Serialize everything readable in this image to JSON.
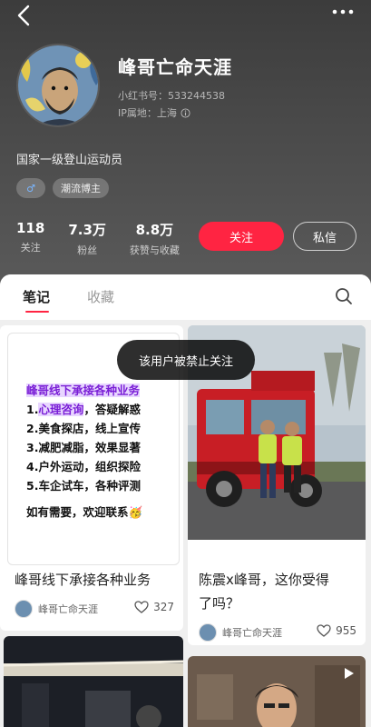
{
  "profile": {
    "name": "峰哥亡命天涯",
    "red_id": "小红书号：533244538",
    "ip": "IP属地：上海",
    "bio": "国家一级登山运动员",
    "tags": [
      "♂",
      "潮流博主"
    ],
    "stats": [
      {
        "value": "118",
        "label": "关注"
      },
      {
        "value": "7.3万",
        "label": "粉丝"
      },
      {
        "value": "8.8万",
        "label": "获赞与收藏"
      }
    ],
    "follow_label": "关注",
    "message_label": "私信"
  },
  "tabs": {
    "notes": "笔记",
    "collections": "收藏"
  },
  "toast": "该用户被禁止关注",
  "posts": [
    {
      "title": "峰哥线下承接各种业务",
      "author": "峰哥亡命天涯",
      "likes": "327",
      "image_lines": {
        "header": "峰哥线下承接各种业务",
        "l1_num": "1.",
        "l1_hl": "心理咨询",
        "l1_rest": "，答疑解惑",
        "l2": "2.美食探店，线上宣传",
        "l3": "3.减肥减脂，效果显著",
        "l4": "4.户外运动，组织探险",
        "l5": "5.车企试车，各种评测",
        "contact": "如有需要，欢迎联系🥳"
      }
    },
    {
      "title_line1": "陈震x峰哥，这你受得",
      "title_line2": "了吗？",
      "author": "峰哥亡命天涯",
      "likes": "955"
    }
  ],
  "icons": [
    "back-arrow-icon",
    "more-dots-icon",
    "info-icon",
    "search-icon",
    "heart-icon",
    "video-play-icon"
  ],
  "colors": {
    "accent": "#ff2442",
    "header_bg": "#434343"
  }
}
